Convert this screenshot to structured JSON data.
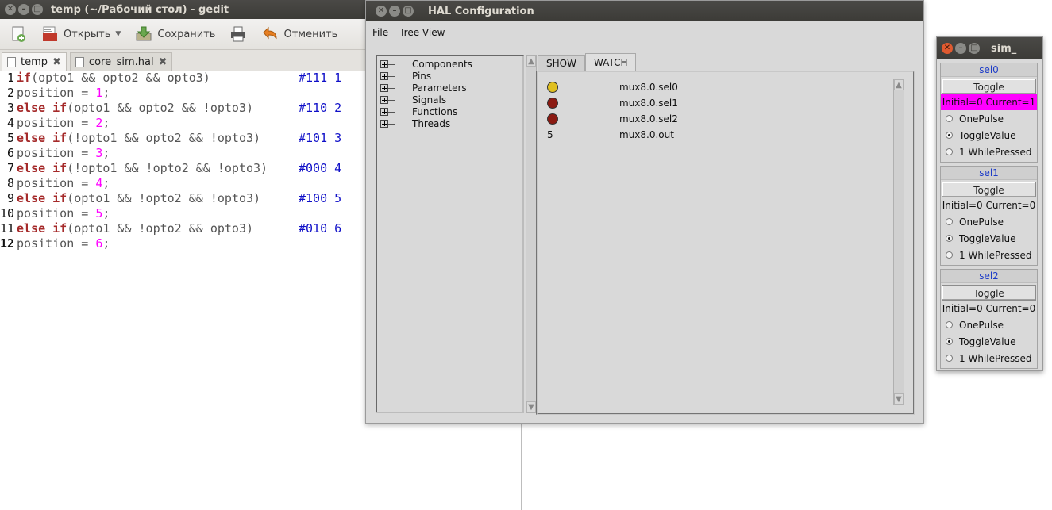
{
  "gedit": {
    "title": "temp (~/Рабочий стол) - gedit",
    "toolbar": {
      "open_label": "Открыть",
      "save_label": "Сохранить",
      "undo_label": "Отменить"
    },
    "tabs": [
      {
        "label": "temp"
      },
      {
        "label": "core_sim.hal"
      }
    ],
    "lines": [
      {
        "n": "1",
        "kw": "if",
        "code": "(opto1 && opto2 && opto3)",
        "num": "",
        "tail": "",
        "comment": "#111 1"
      },
      {
        "n": "2",
        "kw": "",
        "code": "position = ",
        "num": "1",
        "tail": ";",
        "comment": ""
      },
      {
        "n": "3",
        "kw": "else if",
        "code": "(opto1 && opto2 && !opto3)",
        "num": "",
        "tail": "",
        "comment": "#110 2"
      },
      {
        "n": "4",
        "kw": "",
        "code": "position = ",
        "num": "2",
        "tail": ";",
        "comment": ""
      },
      {
        "n": "5",
        "kw": "else if",
        "code": "(!opto1 && opto2 && !opto3)",
        "num": "",
        "tail": "",
        "comment": "#101 3"
      },
      {
        "n": "6",
        "kw": "",
        "code": "position = ",
        "num": "3",
        "tail": ";",
        "comment": ""
      },
      {
        "n": "7",
        "kw": "else if",
        "code": "(!opto1 && !opto2 && !opto3)",
        "num": "",
        "tail": "",
        "comment": "#000 4"
      },
      {
        "n": "8",
        "kw": "",
        "code": "position = ",
        "num": "4",
        "tail": ";",
        "comment": ""
      },
      {
        "n": "9",
        "kw": "else if",
        "code": "(opto1 && !opto2 && !opto3)",
        "num": "",
        "tail": "",
        "comment": "#100 5"
      },
      {
        "n": "10",
        "kw": "",
        "code": "position = ",
        "num": "5",
        "tail": ";",
        "comment": ""
      },
      {
        "n": "11",
        "kw": "else if",
        "code": "(opto1 && !opto2 && opto3)",
        "num": "",
        "tail": "",
        "comment": "#010 6"
      },
      {
        "n": "12",
        "kw": "",
        "code": "position = ",
        "num": "6",
        "tail": ";",
        "comment": ""
      }
    ]
  },
  "hal": {
    "title": "HAL Configuration",
    "menu": [
      "File",
      "Tree View"
    ],
    "tree": [
      "Components",
      "Pins",
      "Parameters",
      "Signals",
      "Functions",
      "Threads"
    ],
    "tabs": [
      "SHOW",
      "WATCH"
    ],
    "watch": [
      {
        "name": "mux8.0.sel0",
        "kind": "led",
        "color": "#e0c020"
      },
      {
        "name": "mux8.0.sel1",
        "kind": "led",
        "color": "#8b1a12"
      },
      {
        "name": "mux8.0.sel2",
        "kind": "led",
        "color": "#8b1a12"
      },
      {
        "name": "mux8.0.out",
        "kind": "value",
        "value": "5"
      }
    ]
  },
  "sim": {
    "title": "sim_",
    "groups": [
      {
        "name": "sel0",
        "button": "Toggle",
        "status": "Initial=0 Current=1",
        "active": true,
        "options": [
          "OnePulse",
          "ToggleValue",
          "1 WhilePressed"
        ],
        "selected": 1
      },
      {
        "name": "sel1",
        "button": "Toggle",
        "status": "Initial=0 Current=0",
        "active": false,
        "options": [
          "OnePulse",
          "ToggleValue",
          "1 WhilePressed"
        ],
        "selected": 1
      },
      {
        "name": "sel2",
        "button": "Toggle",
        "status": "Initial=0 Current=0",
        "active": false,
        "options": [
          "OnePulse",
          "ToggleValue",
          "1 WhilePressed"
        ],
        "selected": 1
      }
    ]
  },
  "colors": {
    "status_active": "#ff00ff",
    "keyword": "#a52a2a",
    "number": "#ff00ff",
    "comment": "#1010c8"
  }
}
